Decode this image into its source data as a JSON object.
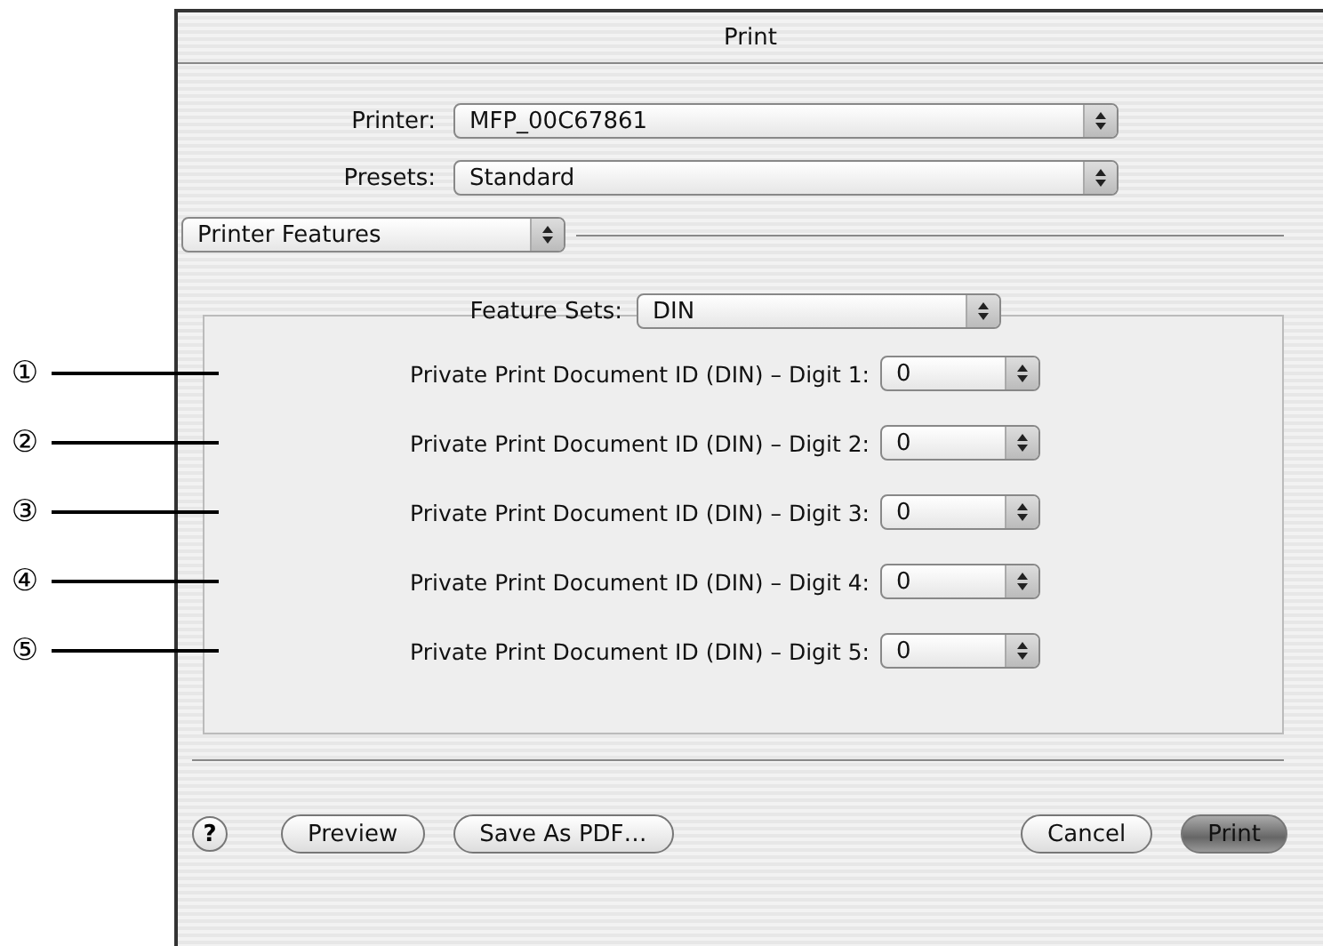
{
  "window": {
    "title": "Print"
  },
  "printer": {
    "label": "Printer:",
    "value": "MFP_00C67861"
  },
  "presets": {
    "label": "Presets:",
    "value": "Standard"
  },
  "pane_menu": {
    "value": "Printer Features"
  },
  "feature_sets": {
    "label": "Feature Sets:",
    "value": "DIN"
  },
  "features": [
    {
      "callout": "①",
      "label": "Private Print Document ID (DIN) – Digit 1:",
      "value": "0"
    },
    {
      "callout": "②",
      "label": "Private Print Document ID (DIN) – Digit 2:",
      "value": "0"
    },
    {
      "callout": "③",
      "label": "Private Print Document ID (DIN) – Digit 3:",
      "value": "0"
    },
    {
      "callout": "④",
      "label": "Private Print Document ID (DIN) – Digit 4:",
      "value": "0"
    },
    {
      "callout": "⑤",
      "label": "Private Print Document ID (DIN) – Digit 5:",
      "value": "0"
    }
  ],
  "help": "?",
  "buttons_left": [
    {
      "label": "Preview",
      "default": false
    },
    {
      "label": "Save As PDF…",
      "default": false
    }
  ],
  "buttons_right": [
    {
      "label": "Cancel",
      "default": false
    },
    {
      "label": "Print",
      "default": true
    }
  ]
}
